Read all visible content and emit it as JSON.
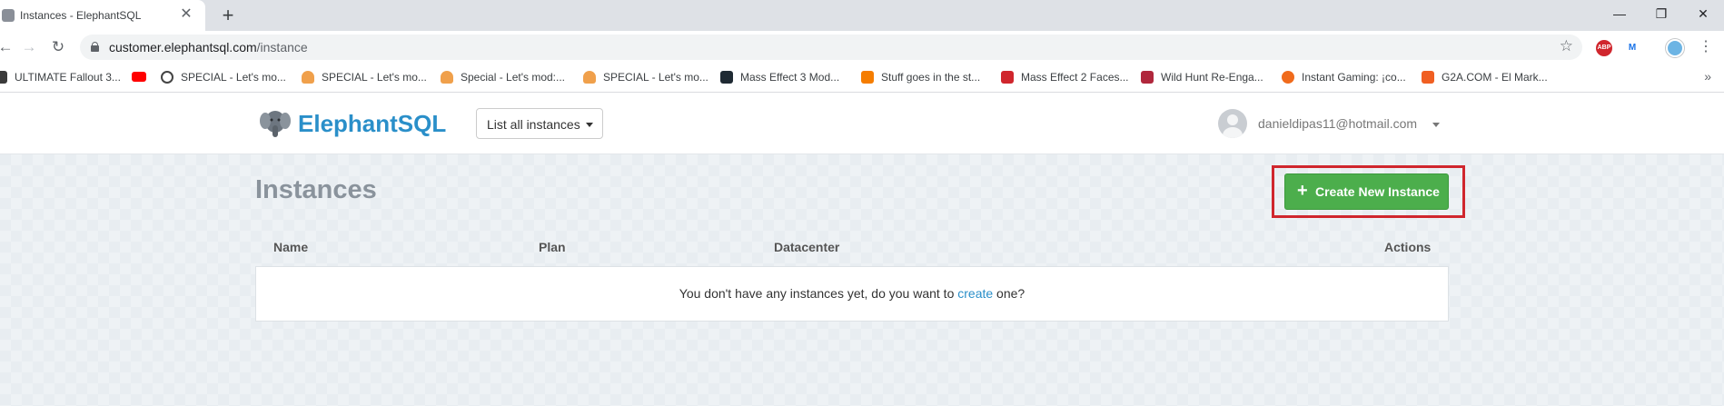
{
  "browser": {
    "tab_title": "Instances - ElephantSQL",
    "tab_close": "✕",
    "new_tab": "+",
    "window_controls": {
      "minimize": "—",
      "restore": "❐",
      "close": "✕"
    },
    "url_host": "customer.elephantsql.com",
    "url_path": "/instance",
    "extensions": [
      {
        "icon": "adblock-plus-icon",
        "label": "ABP",
        "color": "#d0262d"
      },
      {
        "icon": "extension-m-icon",
        "label": "M",
        "color": "#ffffff"
      },
      {
        "icon": "profile-flag-icon",
        "label": "",
        "color": "#6cb4e4"
      }
    ]
  },
  "bookmarks": [
    {
      "icon": "fallout-icon",
      "color": "#3a3a3a",
      "label": "ULTIMATE Fallout 3..."
    },
    {
      "icon": "youtube-icon",
      "color": "#ff0000",
      "label": ""
    },
    {
      "icon": "disc-icon",
      "color": "#444444",
      "label": "SPECIAL - Let's mo..."
    },
    {
      "icon": "shield-icon",
      "color": "#f0a04b",
      "label": "SPECIAL - Let's mo..."
    },
    {
      "icon": "shield-icon",
      "color": "#f0a04b",
      "label": "Special - Let's mod:..."
    },
    {
      "icon": "shield-icon",
      "color": "#f0a04b",
      "label": "SPECIAL - Let's mo..."
    },
    {
      "icon": "mass-effect-icon",
      "color": "#1f2a33",
      "label": "Mass Effect 3 Mod..."
    },
    {
      "icon": "blogger-icon",
      "color": "#f57d00",
      "label": "Stuff goes in the st..."
    },
    {
      "icon": "nexus-icon",
      "color": "#d0262d",
      "label": "Mass Effect 2 Faces..."
    },
    {
      "icon": "witcher-icon",
      "color": "#b0273c",
      "label": "Wild Hunt Re-Enga..."
    },
    {
      "icon": "instant-gaming-icon",
      "color": "#f06b1c",
      "label": "Instant Gaming: ¡co..."
    },
    {
      "icon": "g2a-icon",
      "color": "#f05f22",
      "label": "G2A.COM - El Mark..."
    }
  ],
  "bookmarks_more": "»",
  "app": {
    "brand": "ElephantSQL",
    "instances_dropdown": "List all instances",
    "user_email": "danieldipas11@hotmail.com",
    "page_title": "Instances",
    "create_button": "Create New Instance",
    "create_plus": "+",
    "table_headers": {
      "name": "Name",
      "plan": "Plan",
      "datacenter": "Datacenter",
      "actions": "Actions"
    },
    "empty_before": "You don't have any instances yet, do you want to ",
    "empty_link": "create",
    "empty_after": " one?"
  }
}
